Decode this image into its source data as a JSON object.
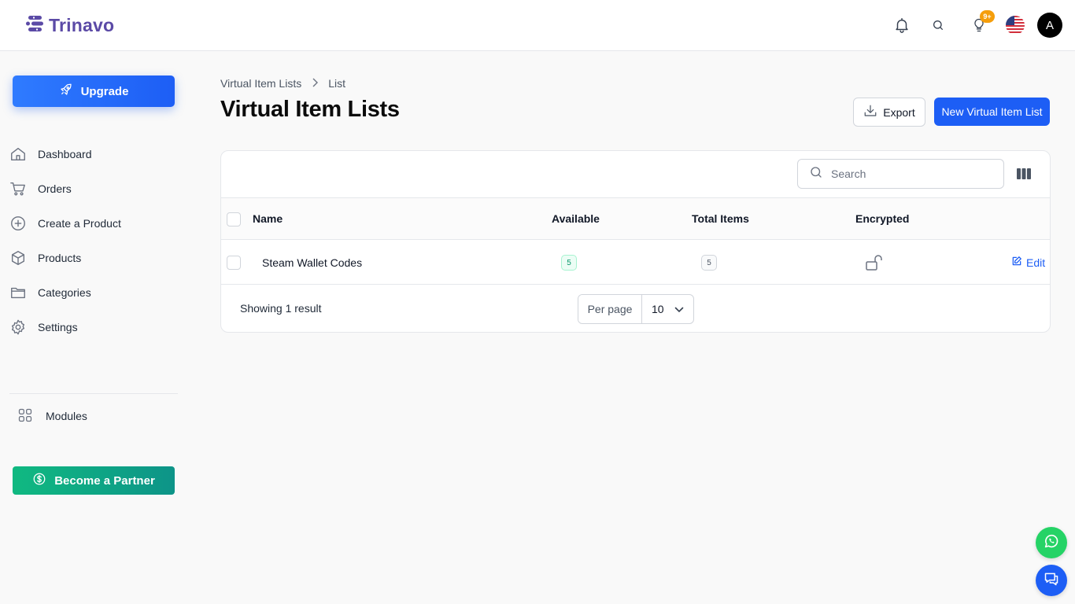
{
  "header": {
    "brand": "Trinavo",
    "notifications_badge": "9+",
    "avatar_initial": "A",
    "icons": [
      "bell-icon",
      "search-icon",
      "lightbulb-icon",
      "us-flag-icon"
    ]
  },
  "sidebar": {
    "upgrade_label": "Upgrade",
    "items": [
      {
        "label": "Dashboard",
        "icon": "home-icon"
      },
      {
        "label": "Orders",
        "icon": "cart-icon"
      },
      {
        "label": "Create a Product",
        "icon": "plus-circle-icon"
      },
      {
        "label": "Products",
        "icon": "box-icon"
      },
      {
        "label": "Categories",
        "icon": "folder-icon"
      },
      {
        "label": "Settings",
        "icon": "gear-icon"
      }
    ],
    "modules_label": "Modules",
    "partner_label": "Become a Partner"
  },
  "breadcrumb": {
    "parent": "Virtual Item Lists",
    "current": "List"
  },
  "page": {
    "title": "Virtual Item Lists",
    "export_label": "Export",
    "new_label": "New Virtual Item List"
  },
  "table": {
    "search_placeholder": "Search",
    "columns": {
      "name": "Name",
      "available": "Available",
      "total": "Total Items",
      "encrypted": "Encrypted"
    },
    "rows": [
      {
        "name": "Steam Wallet Codes",
        "available": "5",
        "total": "5",
        "encrypted": "unlocked",
        "edit_label": "Edit"
      }
    ],
    "footer": {
      "showing": "Showing 1 result",
      "per_page_label": "Per page",
      "per_page_value": "10"
    }
  },
  "colors": {
    "primary": "#1d5ef5",
    "brand": "#5b4aa6",
    "partner": "#10b981",
    "badge": "#f59e0b",
    "whatsapp": "#25d366"
  }
}
